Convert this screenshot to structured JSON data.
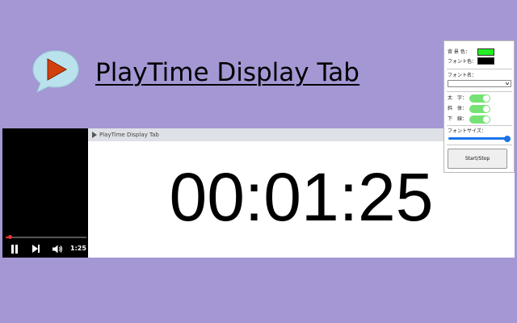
{
  "app": {
    "title": "PlayTime Display Tab"
  },
  "video": {
    "time": "1:25 /",
    "progress": 0.05
  },
  "tab": {
    "title": "PlayTime Display Tab"
  },
  "timer": {
    "display": "00:01:25"
  },
  "settings": {
    "bg_color_label": "背 景 色：",
    "bg_color": "#22ee22",
    "font_color_label": "フォント色：",
    "font_color": "#000000",
    "font_name_label": "フォント名：",
    "font_name_value": "",
    "bold_label": "太　字：",
    "bold_enabled": true,
    "italic_label": "斜　体：",
    "italic_enabled": true,
    "underline_label": "下　線：",
    "underline_enabled": true,
    "font_size_label": "フォントサイズ：",
    "font_size_fraction": 1.0,
    "start_stop_label": "Start/Stop"
  },
  "colors": {
    "page_background": "#a497d4",
    "logo_bubble": "#b9e2ec",
    "logo_play": "#d23f0f",
    "toggle_on": "#76e276",
    "slider_accent": "#1a73e8"
  },
  "icons": {
    "logo": "speech-bubble-play-icon",
    "pause": "pause-icon",
    "next": "skip-next-icon",
    "volume": "volume-icon",
    "tab_play": "play-icon"
  }
}
